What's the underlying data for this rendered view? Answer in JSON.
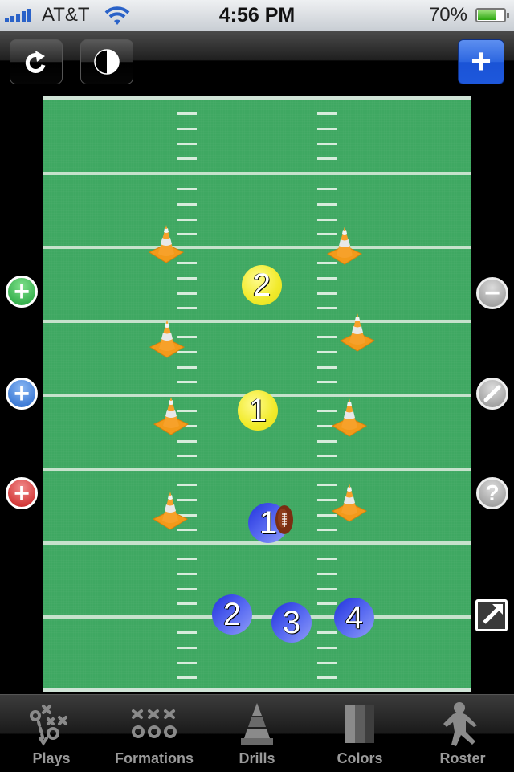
{
  "status_bar": {
    "carrier": "AT&T",
    "time": "4:56 PM",
    "battery_percent": "70%",
    "battery_level": 0.7,
    "signal_bars": 5
  },
  "toolbar": {
    "refresh_icon": "refresh-icon",
    "contrast_icon": "half-circle-contrast-icon",
    "add_label": "+"
  },
  "field": {
    "colors": {
      "grass": "#3fa862",
      "line": "#c6e2cc"
    },
    "yard_lines": 7,
    "cones": [
      {
        "side": "left",
        "row": 1
      },
      {
        "side": "right",
        "row": 1
      },
      {
        "side": "left",
        "row": 2
      },
      {
        "side": "right",
        "row": 2
      },
      {
        "side": "left",
        "row": 3
      },
      {
        "side": "right",
        "row": 3
      },
      {
        "side": "left",
        "row": 4
      },
      {
        "side": "right",
        "row": 4
      }
    ],
    "defense": [
      {
        "label": "2",
        "color": "yellow"
      },
      {
        "label": "1",
        "color": "yellow"
      }
    ],
    "offense": [
      {
        "label": "1",
        "color": "blue",
        "has_ball": true
      },
      {
        "label": "2",
        "color": "blue"
      },
      {
        "label": "3",
        "color": "blue"
      },
      {
        "label": "4",
        "color": "blue"
      }
    ]
  },
  "left_controls": [
    {
      "name": "add-green-player",
      "glyph": "+",
      "color": "#2aa845"
    },
    {
      "name": "add-blue-player",
      "glyph": "+",
      "color": "#2f6fd2"
    },
    {
      "name": "add-red-player",
      "glyph": "+",
      "color": "#cc2424"
    }
  ],
  "right_controls": [
    {
      "name": "remove",
      "glyph": "−"
    },
    {
      "name": "draw",
      "glyph": "/"
    },
    {
      "name": "help",
      "glyph": "?"
    }
  ],
  "tabs": [
    {
      "label": "Plays",
      "icon": "plays-icon"
    },
    {
      "label": "Formations",
      "icon": "formations-icon"
    },
    {
      "label": "Drills",
      "icon": "cone-icon"
    },
    {
      "label": "Colors",
      "icon": "colors-icon"
    },
    {
      "label": "Roster",
      "icon": "player-icon"
    }
  ]
}
